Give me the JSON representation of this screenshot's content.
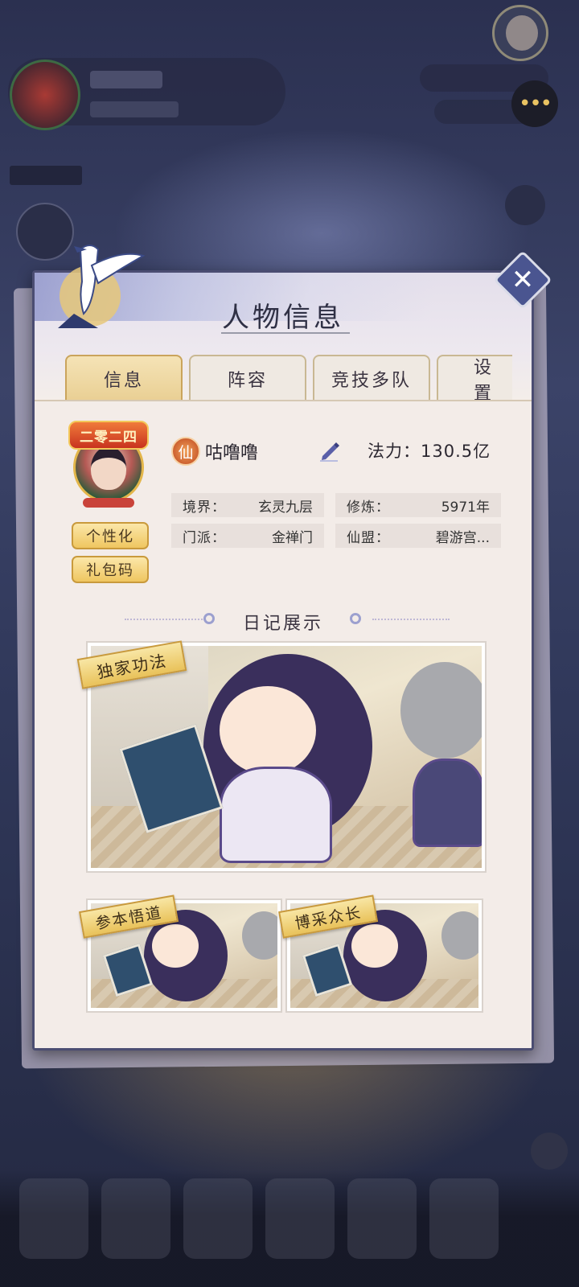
{
  "window": {
    "title": "人物信息"
  },
  "tabs": [
    {
      "label": "信息",
      "active": true
    },
    {
      "label": "阵容",
      "active": false
    },
    {
      "label": "竞技多队",
      "active": false
    },
    {
      "label": "设置",
      "active": false
    }
  ],
  "profile": {
    "badge_text": "二零二四",
    "name": "咕噜噜",
    "power_label": "法力：130.5亿",
    "customize_button": "个性化",
    "gift_code_button": "礼包码",
    "stats": [
      {
        "key": "境界：",
        "value": "玄灵九层"
      },
      {
        "key": "修炼：",
        "value": "5971年"
      },
      {
        "key": "门派：",
        "value": "金禅门"
      },
      {
        "key": "仙盟：",
        "value": "碧游宫..."
      }
    ]
  },
  "diary": {
    "title": "日记展示",
    "main_card": {
      "label": "独家功法"
    },
    "small_cards": [
      {
        "label": "参本悟道"
      },
      {
        "label": "博采众长"
      }
    ]
  },
  "colors": {
    "accent_gold": "#efc660",
    "panel_bg": "#f4eee9",
    "panel_border": "#4b4d72",
    "close_button": "#4a5590"
  },
  "icons": {
    "close": "close-icon",
    "edit": "pencil-icon",
    "sect": "xian-icon",
    "chat": "chat-bubble-icon"
  }
}
